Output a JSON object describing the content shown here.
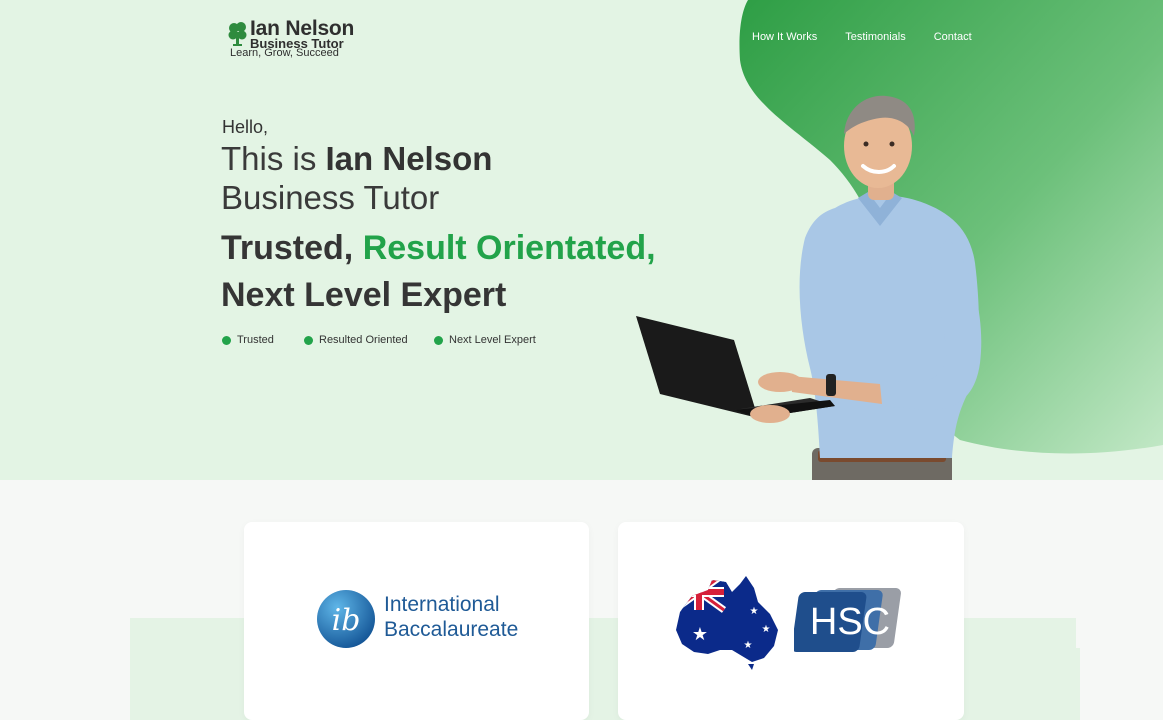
{
  "logo": {
    "name": "Ian Nelson",
    "subtitle": "Business Tutor",
    "tagline": "Learn, Grow, Succeed"
  },
  "nav": {
    "items": [
      "How It Works",
      "Testimonials",
      "Contact"
    ]
  },
  "hero": {
    "greeting": "Hello,",
    "intro_prefix": "This is ",
    "intro_name": "Ian Nelson",
    "role": "Business Tutor",
    "headline_part1": "Trusted, ",
    "headline_part2": "Result Orientated,",
    "headline_line2": "Next Level Expert",
    "bullets": [
      "Trusted",
      "Resulted Oriented",
      "Next Level Expert"
    ]
  },
  "cards": {
    "ib": {
      "line1": "International",
      "line2": "Baccalaureate",
      "mark": "ib"
    },
    "hsc": {
      "mark": "HSC"
    }
  },
  "colors": {
    "accent": "#22a34a",
    "hero_background": "#e3f4e4",
    "blob_green": "#3fae52"
  }
}
